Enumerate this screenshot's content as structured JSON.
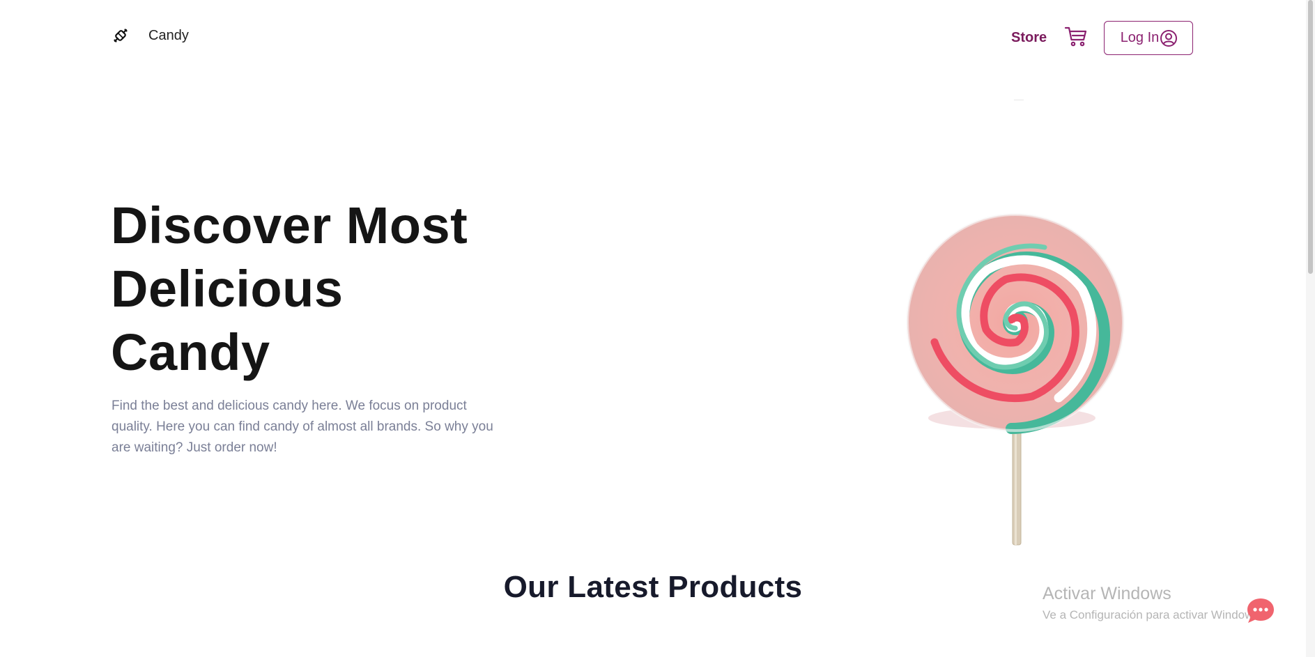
{
  "header": {
    "brand_name": "Candy",
    "store_label": "Store",
    "login_label": "Log In"
  },
  "hero": {
    "title_lines": [
      "Discover Most",
      "Delicious",
      "Candy"
    ],
    "description": "Find the best and delicious candy here. We focus on product quality. Here you can find candy of almost all brands. So why you are waiting? Just order now!"
  },
  "products": {
    "section_title": "Our Latest Products"
  },
  "watermark": {
    "title": "Activar Windows",
    "subtitle": "Ve a Configuración para activar Windows."
  },
  "icons": {
    "brand": "candy-icon",
    "cart": "cart-icon",
    "login": "user-circle-icon",
    "chat": "chat-icon"
  },
  "colors": {
    "accent": "#8b2170",
    "store_link": "#7a1a5c",
    "title": "#151515",
    "body_text": "#7a7f96",
    "chat_bubble": "#f0646e"
  }
}
